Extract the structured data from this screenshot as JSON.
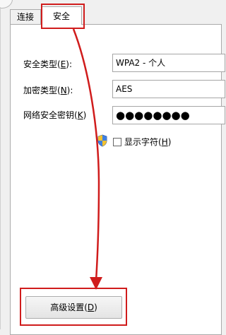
{
  "tabs": [
    {
      "label": "连接",
      "active": false
    },
    {
      "label": "安全",
      "active": true
    }
  ],
  "form": {
    "security_type": {
      "label_text": "安全类型(",
      "mnemonic": "E",
      "label_end": "):",
      "value": "WPA2 - 个人"
    },
    "encryption_type": {
      "label_text": "加密类型(",
      "mnemonic": "N",
      "label_end": "):",
      "value": "AES"
    },
    "network_key": {
      "label_text": "网络安全密钥(",
      "mnemonic": "K",
      "label_end": ")",
      "value": "●●●●●●●●"
    },
    "show_chars": {
      "label_text": "显示字符(",
      "mnemonic": "H",
      "label_end": ")",
      "checked": false
    }
  },
  "advanced_button": {
    "label_text": "高级设置(",
    "mnemonic": "D",
    "label_end": ")"
  },
  "colors": {
    "annotation_red": "#d01c1c",
    "panel_background": "#ffffff",
    "window_background": "#f0f0f0"
  },
  "icons": {
    "shield": "uac-shield-icon"
  }
}
